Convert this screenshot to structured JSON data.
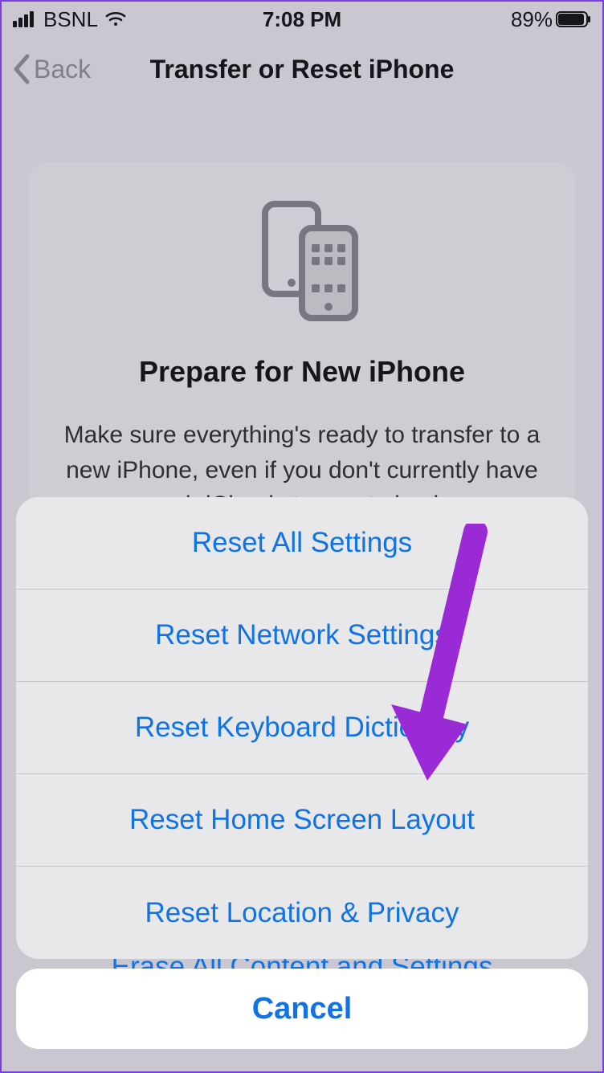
{
  "status_bar": {
    "carrier": "BSNL",
    "time": "7:08 PM",
    "battery_percent": "89%"
  },
  "nav": {
    "back_label": "Back",
    "title": "Transfer or Reset iPhone"
  },
  "card": {
    "title": "Prepare for New iPhone",
    "description": "Make sure everything's ready to transfer to a new iPhone, even if you don't currently have enough iCloud storage to back up."
  },
  "sheet": {
    "items": [
      "Reset All Settings",
      "Reset Network Settings",
      "Reset Keyboard Dictionary",
      "Reset Home Screen Layout",
      "Reset Location & Privacy"
    ],
    "peek_item": "Erase All Content and Settings",
    "cancel_label": "Cancel"
  },
  "annotation": {
    "arrow_color": "#9a2ad6"
  }
}
